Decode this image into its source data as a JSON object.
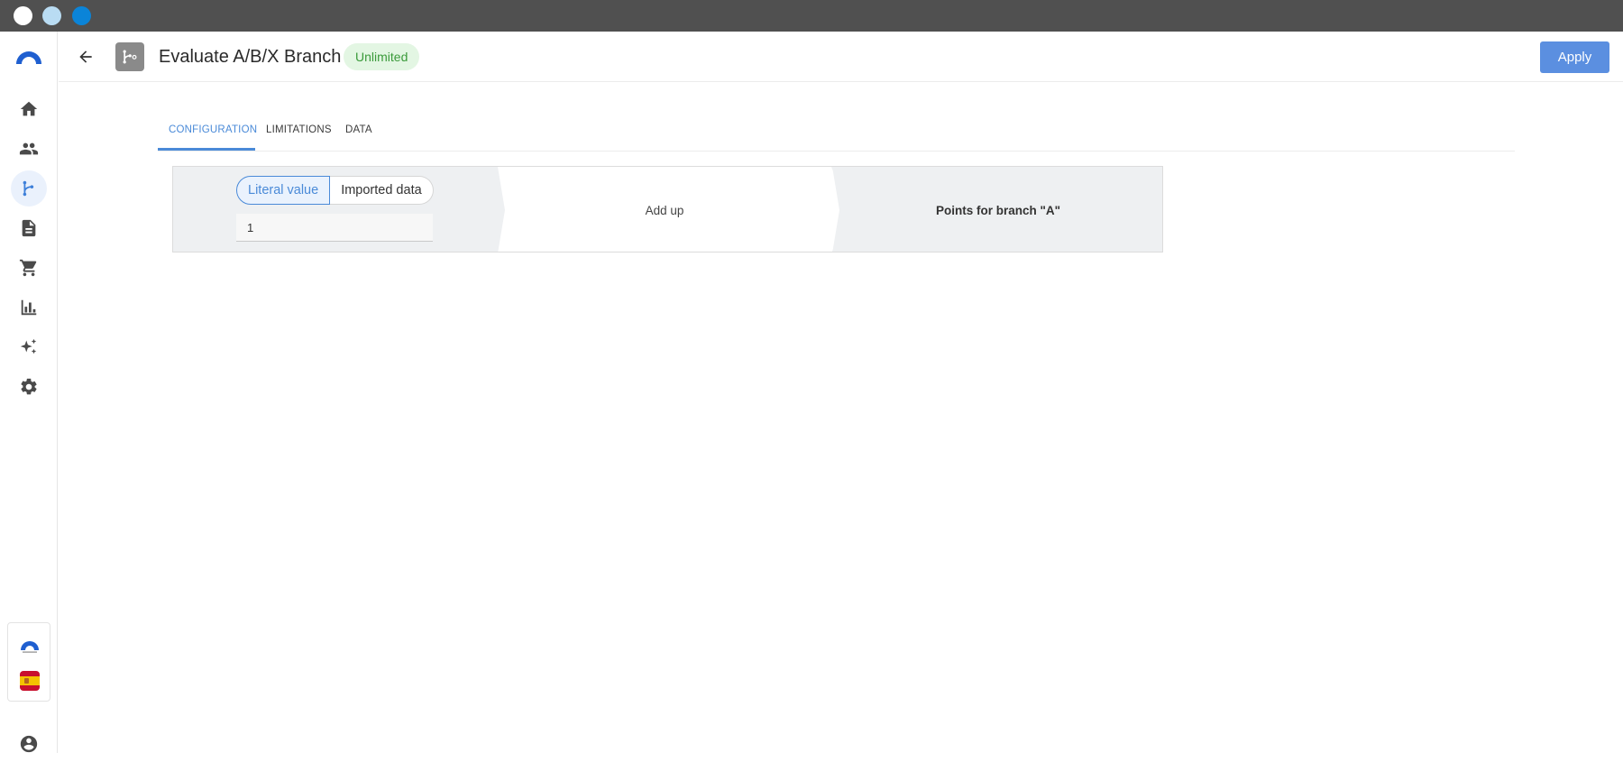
{
  "window": {
    "controls": [
      "close",
      "minimize",
      "maximize"
    ]
  },
  "sidebar": {
    "logo": "app-logo",
    "items": [
      {
        "name": "home",
        "icon": "home-icon"
      },
      {
        "name": "users",
        "icon": "people-icon"
      },
      {
        "name": "flows",
        "icon": "branch-icon",
        "active": true
      },
      {
        "name": "documents",
        "icon": "document-icon"
      },
      {
        "name": "shop",
        "icon": "cart-icon"
      },
      {
        "name": "reports",
        "icon": "bar-chart-icon"
      },
      {
        "name": "ai",
        "icon": "sparkles-icon"
      },
      {
        "name": "settings",
        "icon": "gear-icon"
      }
    ],
    "footer": {
      "brand_icon": "mini-logo-icon",
      "language": "spain-flag-icon",
      "profile": "account-circle-icon"
    }
  },
  "header": {
    "title": "Evaluate A/B/X Branch",
    "badge": "Unlimited",
    "apply_label": "Apply"
  },
  "tabs": [
    {
      "label": "CONFIGURATION",
      "active": true
    },
    {
      "label": "LIMITATIONS",
      "active": false
    },
    {
      "label": "DATA",
      "active": false
    }
  ],
  "rule": {
    "source_options": [
      "Literal value",
      "Imported data"
    ],
    "selected_source": "Literal value",
    "value": "1",
    "operation": "Add up",
    "target": "Points for branch \"A\""
  },
  "colors": {
    "accent": "#4a8ad8",
    "apply_button": "#5b8fe0",
    "badge_bg": "#e3f6e3",
    "badge_text": "#3a9a3a"
  }
}
